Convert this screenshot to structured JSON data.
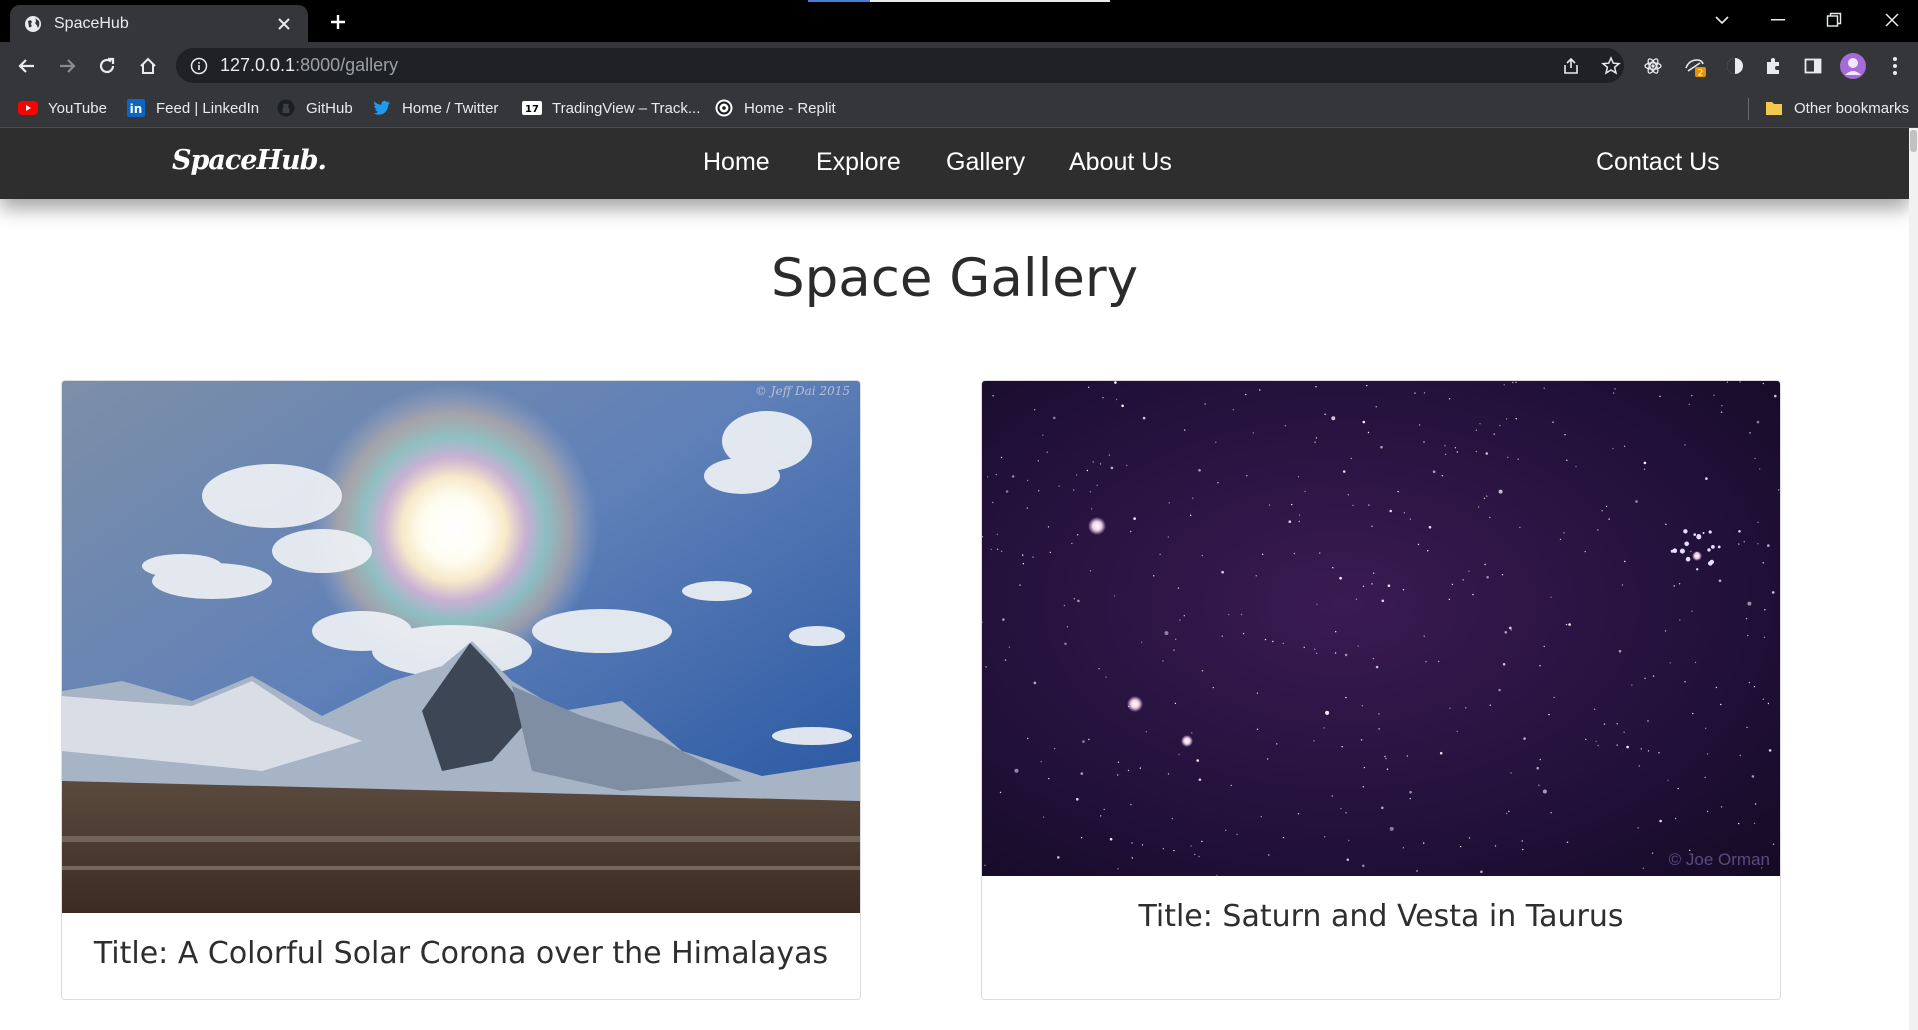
{
  "browser": {
    "tab": {
      "title": "SpaceHub"
    },
    "address": {
      "host": "127.0.0.1",
      "path": ":8000/gallery"
    },
    "extension_badge": "2",
    "bookmarks": [
      {
        "label": "YouTube",
        "icon": "youtube-icon"
      },
      {
        "label": "Feed | LinkedIn",
        "icon": "linkedin-icon"
      },
      {
        "label": "GitHub",
        "icon": "github-icon"
      },
      {
        "label": "Home / Twitter",
        "icon": "twitter-icon"
      },
      {
        "label": "TradingView – Track...",
        "icon": "tradingview-icon"
      },
      {
        "label": "Home - Replit",
        "icon": "replit-icon"
      }
    ],
    "other_bookmarks": "Other bookmarks"
  },
  "site": {
    "logo": "SpaceHub.",
    "nav": [
      "Home",
      "Explore",
      "Gallery",
      "About Us"
    ],
    "contact": "Contact Us"
  },
  "page": {
    "title": "Space Gallery",
    "cards": [
      {
        "caption": "Title: A Colorful Solar Corona over the Himalayas",
        "credit": "© Jeff Dai 2015"
      },
      {
        "caption": "Title: Saturn and Vesta in Taurus",
        "credit": "© Joe Orman"
      }
    ]
  },
  "colors": {
    "chrome_dark": "#35363a",
    "nav_bg": "#2e2e2e",
    "accent_blue": "#4a7bd6"
  }
}
